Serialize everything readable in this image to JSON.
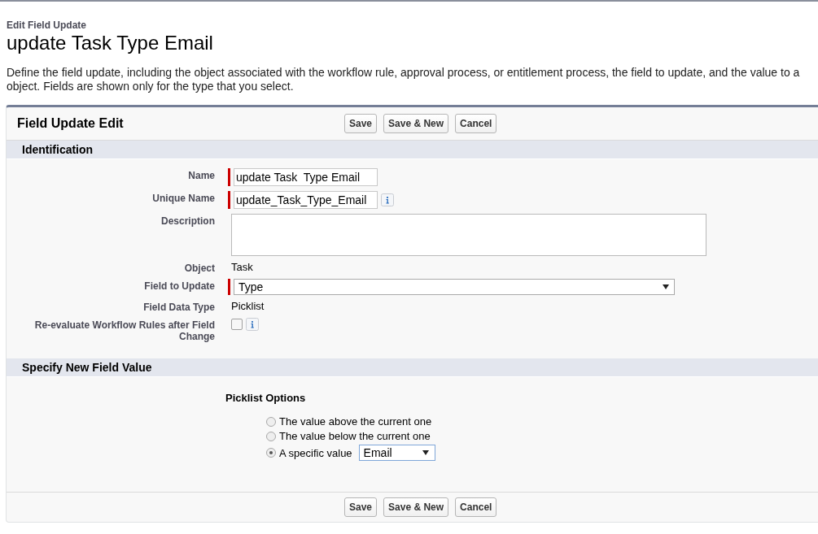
{
  "header": {
    "breadcrumb": "Edit Field Update",
    "title": "update Task Type Email"
  },
  "description_lines": [
    "Define the field update, including the object associated with the workflow rule, approval process, or entitlement process, the field to update, and the value to a",
    "object. Fields are shown only for the type that you select."
  ],
  "panel": {
    "title": "Field Update Edit",
    "top_buttons": [
      "Save",
      "Save & New",
      "Cancel"
    ],
    "bottom_buttons": [
      "Save",
      "Save & New",
      "Cancel"
    ]
  },
  "identification": {
    "title": "Identification",
    "fields": [
      {
        "kind": "text",
        "label": "Name",
        "value": "update Task  Type Email",
        "required": true,
        "info": false
      },
      {
        "kind": "text",
        "label": "Unique Name",
        "value": "update_Task_Type_Email",
        "required": true,
        "info": true
      },
      {
        "kind": "textarea",
        "label": "Description",
        "required": false
      },
      {
        "kind": "static",
        "label": "Object",
        "value": "Task"
      },
      {
        "kind": "select",
        "label": "Field to Update",
        "value": "Type",
        "required": true
      },
      {
        "kind": "static",
        "label": "Field Data Type",
        "value": "Picklist"
      },
      {
        "kind": "checkbox",
        "label": "Re-evaluate Workflow Rules after Field Change",
        "checked": false,
        "info": true
      }
    ]
  },
  "new_value": {
    "title": "Specify New Field Value",
    "heading": "Picklist Options",
    "options": [
      {
        "label": "The value above the current one",
        "selected": false
      },
      {
        "label": "The value below the current one",
        "selected": false
      },
      {
        "label": "A specific value",
        "selected": true,
        "select_value": "Email"
      }
    ]
  }
}
